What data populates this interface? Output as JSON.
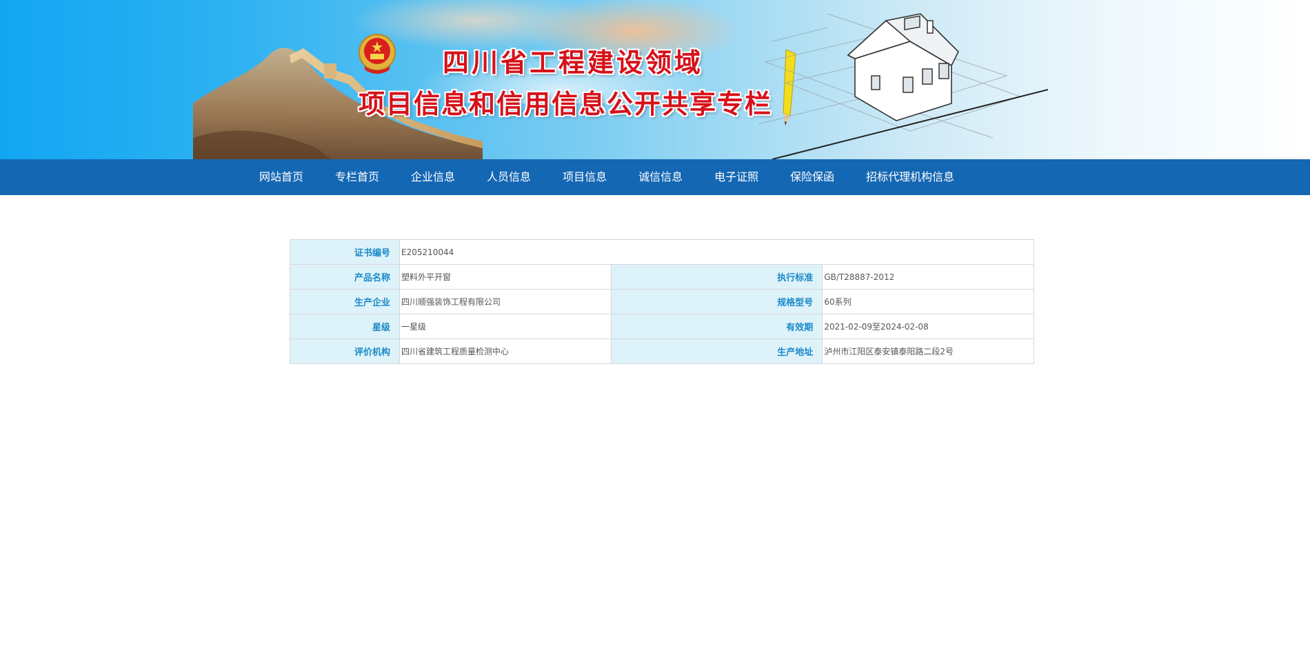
{
  "banner": {
    "title_line1": "四川省工程建设领域",
    "title_line2": "项目信息和信用信息公开共享专栏",
    "emblem_icon": "national-emblem-icon"
  },
  "nav": {
    "items": [
      {
        "label": "网站首页"
      },
      {
        "label": "专栏首页"
      },
      {
        "label": "企业信息"
      },
      {
        "label": "人员信息"
      },
      {
        "label": "项目信息"
      },
      {
        "label": "诚信信息"
      },
      {
        "label": "电子证照"
      },
      {
        "label": "保险保函"
      },
      {
        "label": "招标代理机构信息"
      }
    ]
  },
  "certificate": {
    "cert_no_label": "证书编号",
    "cert_no": "E205210044",
    "product_name_label": "产品名称",
    "product_name": "塑料外平开窗",
    "standard_label": "执行标准",
    "standard": "GB/T28887-2012",
    "manufacturer_label": "生产企业",
    "manufacturer": "四川顺强装饰工程有限公司",
    "model_label": "规格型号",
    "model": "60系列",
    "star_label": "星级",
    "star": "一星级",
    "validity_label": "有效期",
    "validity": "2021-02-09至2024-02-08",
    "org_label": "评价机构",
    "org": "四川省建筑工程质量检测中心",
    "address_label": "生产地址",
    "address": "泸州市江阳区泰安镇泰阳路二段2号"
  },
  "colors": {
    "nav_bg": "#1467b3",
    "label_bg": "#def2fa",
    "label_text": "#1a8ac8",
    "title_red": "#d6111a"
  }
}
